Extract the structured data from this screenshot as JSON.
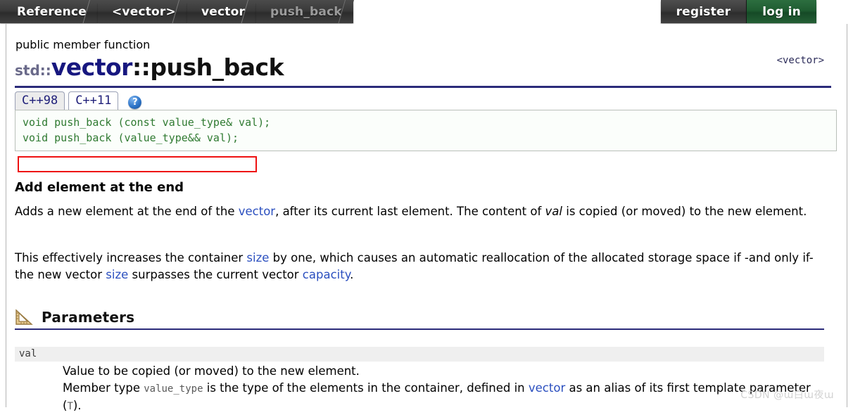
{
  "nav": {
    "breadcrumbs": [
      {
        "label": "Reference",
        "current": false
      },
      {
        "label": "<vector>",
        "current": false
      },
      {
        "label": "vector",
        "current": false
      },
      {
        "label": "push_back",
        "current": true
      }
    ],
    "register_label": "register",
    "login_label": "log in"
  },
  "page": {
    "kind": "public member function",
    "header_include": "<vector>",
    "title_std": "std::",
    "title_class": "vector",
    "title_member": "::push_back"
  },
  "tabs": {
    "items": [
      {
        "label": "C++98",
        "selected": true
      },
      {
        "label": "C++11",
        "selected": false
      }
    ],
    "help_glyph": "?"
  },
  "prototype": {
    "lines": [
      "void push_back (const value_type& val);",
      "void push_back (value_type&& val);"
    ],
    "highlight_color": "#ee1111",
    "code_color": "#2f7a31"
  },
  "description": {
    "heading": "Add element at the end",
    "p1_a": "Adds a new element at the end of the ",
    "p1_link": "vector",
    "p1_b": ", after its current last element. The content of ",
    "p1_em": "val",
    "p1_c": " is copied (or moved) to the new element.",
    "p2_a": "This effectively increases the container ",
    "p2_link1": "size",
    "p2_b": " by one, which causes an automatic reallocation of the allocated storage space if -and only if- the new vector ",
    "p2_link2": "size",
    "p2_c": " surpasses the current vector ",
    "p2_link3": "capacity",
    "p2_d": "."
  },
  "parameters": {
    "section_title": "Parameters",
    "icon": "triangle-ruler-icon",
    "name": "val",
    "desc_line1": "Value to be copied (or moved) to the new element.",
    "desc_line2_a": "Member type ",
    "desc_line2_code": "value_type",
    "desc_line2_b": " is the type of the elements in the container, defined in ",
    "desc_line2_link": "vector",
    "desc_line2_c": " as an alias of its first template parameter (",
    "desc_line2_code2": "T",
    "desc_line2_d": ")."
  },
  "watermark": "CSDN @ɯ白ɯ夜ɯ"
}
